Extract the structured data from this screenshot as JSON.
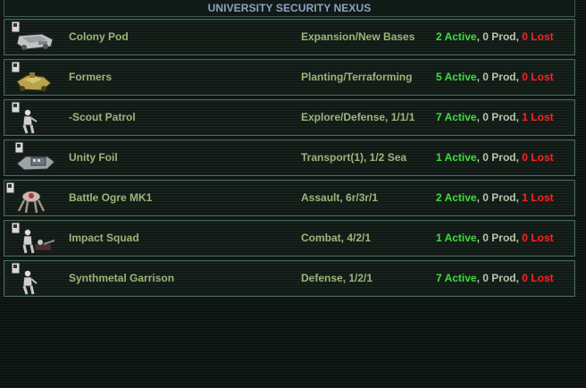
{
  "title": "UNIVERSITY SECURITY NEXUS",
  "units": [
    {
      "name": "Colony Pod",
      "role": "Expansion/New Bases",
      "active": "2 Active",
      "prod": "0 Prod",
      "lost": "0 Lost",
      "icon": "colony-pod-icon"
    },
    {
      "name": "Formers",
      "role": "Planting/Terraforming",
      "active": "5 Active",
      "prod": "0 Prod",
      "lost": "0 Lost",
      "icon": "formers-icon"
    },
    {
      "name": "-Scout Patrol",
      "role": "Explore/Defense, 1/1/1",
      "active": "7 Active",
      "prod": "0 Prod",
      "lost": "1 Lost",
      "icon": "scout-patrol-icon"
    },
    {
      "name": "Unity Foil",
      "role": "Transport(1), 1/2 Sea",
      "active": "1 Active",
      "prod": "0 Prod",
      "lost": "0 Lost",
      "icon": "unity-foil-icon"
    },
    {
      "name": "Battle Ogre MK1",
      "role": "Assault, 6r/3r/1",
      "active": "2 Active",
      "prod": "0 Prod",
      "lost": "1 Lost",
      "icon": "battle-ogre-icon"
    },
    {
      "name": "Impact Squad",
      "role": "Combat, 4/2/1",
      "active": "1 Active",
      "prod": "0 Prod",
      "lost": "0 Lost",
      "icon": "impact-squad-icon"
    },
    {
      "name": "Synthmetal Garrison",
      "role": "Defense, 1/2/1",
      "active": "7 Active",
      "prod": "0 Prod",
      "lost": "0 Lost",
      "icon": "synthmetal-garrison-icon"
    }
  ],
  "colors": {
    "active": "#3ddd3d",
    "lost": "#ff2020",
    "text": "#9bb57a",
    "title": "#8da3c4"
  }
}
